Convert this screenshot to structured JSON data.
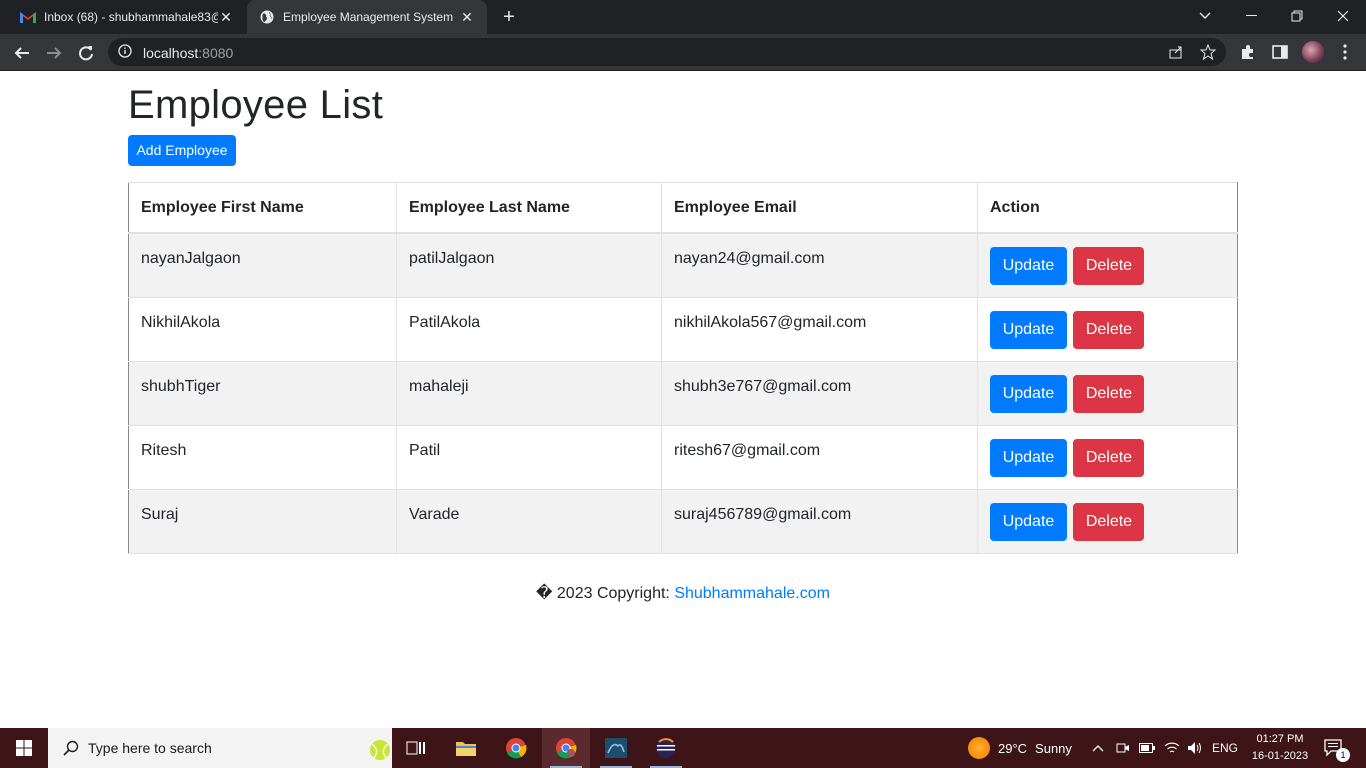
{
  "browser": {
    "tabs": [
      {
        "title": "Inbox (68) - shubhammahale83@",
        "icon": "gmail-icon",
        "active": false
      },
      {
        "title": "Employee Management System",
        "icon": "globe-icon",
        "active": true
      }
    ],
    "url_host": "localhost",
    "url_port": ":8080"
  },
  "page": {
    "heading": "Employee List",
    "add_button": "Add Employee",
    "table": {
      "headers": [
        "Employee First Name",
        "Employee Last Name",
        "Employee Email",
        "Action"
      ],
      "rows": [
        {
          "first": "nayanJalgaon",
          "last": "patilJalgaon",
          "email": "nayan24@gmail.com"
        },
        {
          "first": "NikhilAkola",
          "last": "PatilAkola",
          "email": "nikhilAkola567@gmail.com"
        },
        {
          "first": "shubhTiger",
          "last": "mahaleji",
          "email": "shubh3e767@gmail.com"
        },
        {
          "first": "Ritesh",
          "last": "Patil",
          "email": "ritesh67@gmail.com"
        },
        {
          "first": "Suraj",
          "last": "Varade",
          "email": "suraj456789@gmail.com"
        }
      ],
      "update_label": "Update",
      "delete_label": "Delete"
    },
    "footer_prefix": "� 2023 Copyright: ",
    "footer_link": "Shubhammahale.com",
    "colors": {
      "primary": "#007bff",
      "danger": "#dc3545",
      "stripe": "#f2f2f2"
    }
  },
  "taskbar": {
    "search_placeholder": "Type here to search",
    "weather": {
      "temp": "29°C",
      "condition": "Sunny"
    },
    "language": "ENG",
    "time": "01:27 PM",
    "date": "16-01-2023",
    "notification_count": "1"
  }
}
